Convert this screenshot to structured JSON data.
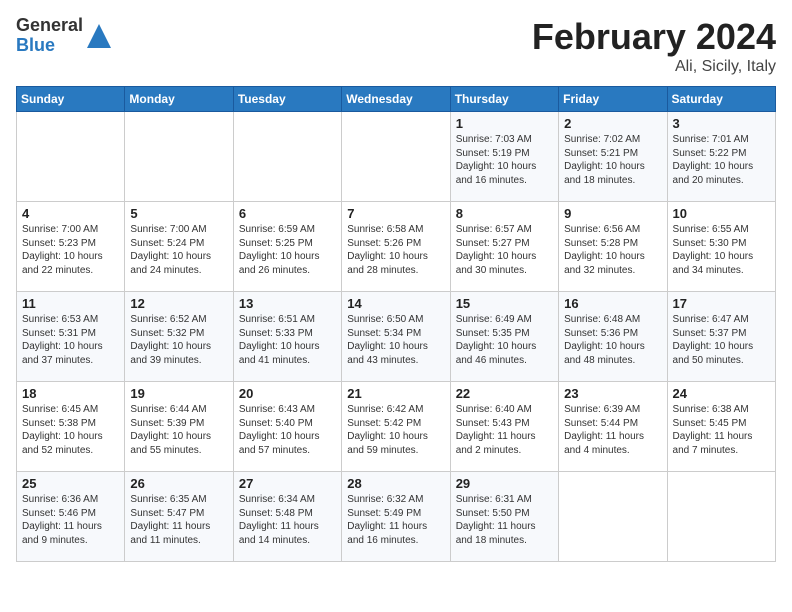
{
  "header": {
    "logo_general": "General",
    "logo_blue": "Blue",
    "title": "February 2024",
    "location": "Ali, Sicily, Italy"
  },
  "days_of_week": [
    "Sunday",
    "Monday",
    "Tuesday",
    "Wednesday",
    "Thursday",
    "Friday",
    "Saturday"
  ],
  "weeks": [
    [
      {
        "day": "",
        "content": ""
      },
      {
        "day": "",
        "content": ""
      },
      {
        "day": "",
        "content": ""
      },
      {
        "day": "",
        "content": ""
      },
      {
        "day": "1",
        "content": "Sunrise: 7:03 AM\nSunset: 5:19 PM\nDaylight: 10 hours\nand 16 minutes."
      },
      {
        "day": "2",
        "content": "Sunrise: 7:02 AM\nSunset: 5:21 PM\nDaylight: 10 hours\nand 18 minutes."
      },
      {
        "day": "3",
        "content": "Sunrise: 7:01 AM\nSunset: 5:22 PM\nDaylight: 10 hours\nand 20 minutes."
      }
    ],
    [
      {
        "day": "4",
        "content": "Sunrise: 7:00 AM\nSunset: 5:23 PM\nDaylight: 10 hours\nand 22 minutes."
      },
      {
        "day": "5",
        "content": "Sunrise: 7:00 AM\nSunset: 5:24 PM\nDaylight: 10 hours\nand 24 minutes."
      },
      {
        "day": "6",
        "content": "Sunrise: 6:59 AM\nSunset: 5:25 PM\nDaylight: 10 hours\nand 26 minutes."
      },
      {
        "day": "7",
        "content": "Sunrise: 6:58 AM\nSunset: 5:26 PM\nDaylight: 10 hours\nand 28 minutes."
      },
      {
        "day": "8",
        "content": "Sunrise: 6:57 AM\nSunset: 5:27 PM\nDaylight: 10 hours\nand 30 minutes."
      },
      {
        "day": "9",
        "content": "Sunrise: 6:56 AM\nSunset: 5:28 PM\nDaylight: 10 hours\nand 32 minutes."
      },
      {
        "day": "10",
        "content": "Sunrise: 6:55 AM\nSunset: 5:30 PM\nDaylight: 10 hours\nand 34 minutes."
      }
    ],
    [
      {
        "day": "11",
        "content": "Sunrise: 6:53 AM\nSunset: 5:31 PM\nDaylight: 10 hours\nand 37 minutes."
      },
      {
        "day": "12",
        "content": "Sunrise: 6:52 AM\nSunset: 5:32 PM\nDaylight: 10 hours\nand 39 minutes."
      },
      {
        "day": "13",
        "content": "Sunrise: 6:51 AM\nSunset: 5:33 PM\nDaylight: 10 hours\nand 41 minutes."
      },
      {
        "day": "14",
        "content": "Sunrise: 6:50 AM\nSunset: 5:34 PM\nDaylight: 10 hours\nand 43 minutes."
      },
      {
        "day": "15",
        "content": "Sunrise: 6:49 AM\nSunset: 5:35 PM\nDaylight: 10 hours\nand 46 minutes."
      },
      {
        "day": "16",
        "content": "Sunrise: 6:48 AM\nSunset: 5:36 PM\nDaylight: 10 hours\nand 48 minutes."
      },
      {
        "day": "17",
        "content": "Sunrise: 6:47 AM\nSunset: 5:37 PM\nDaylight: 10 hours\nand 50 minutes."
      }
    ],
    [
      {
        "day": "18",
        "content": "Sunrise: 6:45 AM\nSunset: 5:38 PM\nDaylight: 10 hours\nand 52 minutes."
      },
      {
        "day": "19",
        "content": "Sunrise: 6:44 AM\nSunset: 5:39 PM\nDaylight: 10 hours\nand 55 minutes."
      },
      {
        "day": "20",
        "content": "Sunrise: 6:43 AM\nSunset: 5:40 PM\nDaylight: 10 hours\nand 57 minutes."
      },
      {
        "day": "21",
        "content": "Sunrise: 6:42 AM\nSunset: 5:42 PM\nDaylight: 10 hours\nand 59 minutes."
      },
      {
        "day": "22",
        "content": "Sunrise: 6:40 AM\nSunset: 5:43 PM\nDaylight: 11 hours\nand 2 minutes."
      },
      {
        "day": "23",
        "content": "Sunrise: 6:39 AM\nSunset: 5:44 PM\nDaylight: 11 hours\nand 4 minutes."
      },
      {
        "day": "24",
        "content": "Sunrise: 6:38 AM\nSunset: 5:45 PM\nDaylight: 11 hours\nand 7 minutes."
      }
    ],
    [
      {
        "day": "25",
        "content": "Sunrise: 6:36 AM\nSunset: 5:46 PM\nDaylight: 11 hours\nand 9 minutes."
      },
      {
        "day": "26",
        "content": "Sunrise: 6:35 AM\nSunset: 5:47 PM\nDaylight: 11 hours\nand 11 minutes."
      },
      {
        "day": "27",
        "content": "Sunrise: 6:34 AM\nSunset: 5:48 PM\nDaylight: 11 hours\nand 14 minutes."
      },
      {
        "day": "28",
        "content": "Sunrise: 6:32 AM\nSunset: 5:49 PM\nDaylight: 11 hours\nand 16 minutes."
      },
      {
        "day": "29",
        "content": "Sunrise: 6:31 AM\nSunset: 5:50 PM\nDaylight: 11 hours\nand 18 minutes."
      },
      {
        "day": "",
        "content": ""
      },
      {
        "day": "",
        "content": ""
      }
    ]
  ]
}
